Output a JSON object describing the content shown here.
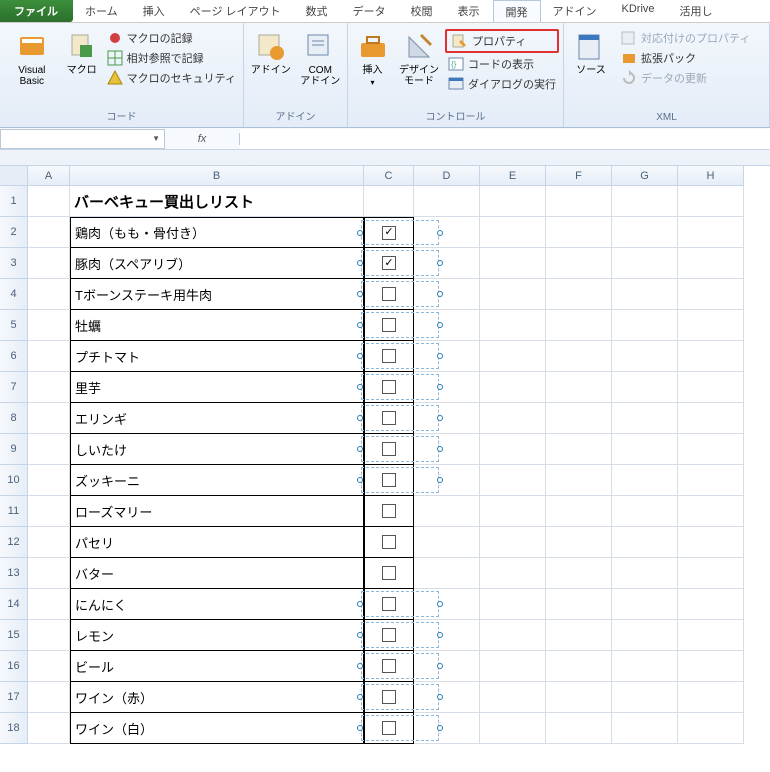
{
  "tabs": {
    "file": "ファイル",
    "home": "ホーム",
    "insert": "挿入",
    "page_layout": "ページ レイアウト",
    "formulas": "数式",
    "data": "データ",
    "review": "校閲",
    "view": "表示",
    "developer": "開発",
    "addins": "アドイン",
    "kdrive": "KDrive",
    "usage": "活用し"
  },
  "ribbon": {
    "code": {
      "label": "コード",
      "visual_basic": "Visual Basic",
      "macros": "マクロ",
      "record_macro": "マクロの記録",
      "relative_ref": "相対参照で記録",
      "macro_security": "マクロのセキュリティ"
    },
    "addins_grp": {
      "label": "アドイン",
      "addins": "アドイン",
      "com_addins": "COM\nアドイン"
    },
    "controls": {
      "label": "コントロール",
      "insert": "挿入",
      "design_mode": "デザイン\nモード",
      "properties": "プロパティ",
      "view_code": "コードの表示",
      "run_dialog": "ダイアログの実行"
    },
    "xml": {
      "label": "XML",
      "source": "ソース",
      "map_properties": "対応付けのプロパティ",
      "expansion_packs": "拡張パック",
      "refresh_data": "データの更新"
    }
  },
  "formula_bar": {
    "fx": "fx"
  },
  "columns": [
    "A",
    "B",
    "C",
    "D",
    "E",
    "F",
    "G",
    "H"
  ],
  "title": "バーベキュー買出しリスト",
  "items": [
    {
      "name": "鶏肉（もも・骨付き）",
      "checked": true,
      "sel": true
    },
    {
      "name": "豚肉（スペアリブ）",
      "checked": true,
      "sel": true
    },
    {
      "name": "Tボーンステーキ用牛肉",
      "checked": false,
      "sel": true
    },
    {
      "name": "牡蠣",
      "checked": false,
      "sel": true
    },
    {
      "name": "プチトマト",
      "checked": false,
      "sel": true
    },
    {
      "name": "里芋",
      "checked": false,
      "sel": true
    },
    {
      "name": "エリンギ",
      "checked": false,
      "sel": true
    },
    {
      "name": "しいたけ",
      "checked": false,
      "sel": true
    },
    {
      "name": "ズッキーニ",
      "checked": false,
      "sel": true
    },
    {
      "name": "ローズマリー",
      "checked": false,
      "sel": false
    },
    {
      "name": "パセリ",
      "checked": false,
      "sel": false
    },
    {
      "name": "バター",
      "checked": false,
      "sel": false
    },
    {
      "name": "にんにく",
      "checked": false,
      "sel": true
    },
    {
      "name": "レモン",
      "checked": false,
      "sel": true
    },
    {
      "name": "ビール",
      "checked": false,
      "sel": true
    },
    {
      "name": "ワイン（赤）",
      "checked": false,
      "sel": true
    },
    {
      "name": "ワイン（白）",
      "checked": false,
      "sel": true
    }
  ]
}
